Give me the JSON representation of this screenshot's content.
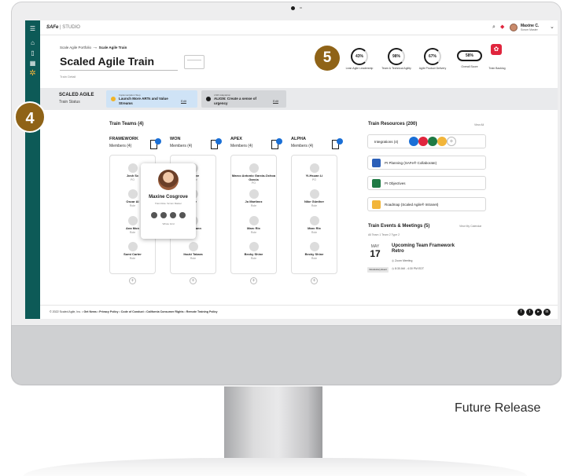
{
  "caption": "Future Release",
  "brand": {
    "logo": "SAFe",
    "sep": " | ",
    "product": "STUDIO"
  },
  "user": {
    "name": "Maxine C.",
    "role": "Scrum Master"
  },
  "breadcrumb": {
    "parent": "Scale Agile Portfolio",
    "arrow": "→",
    "current": "Scale Agile Train"
  },
  "page": {
    "title": "Scaled Agile Train",
    "subtitle": "Train Detail"
  },
  "callouts": {
    "five": "5",
    "four": "4"
  },
  "metrics": [
    {
      "value": "43%",
      "label": "Lean Agile Leadership"
    },
    {
      "value": "98%",
      "label": "Team & Technical Agility"
    },
    {
      "value": "67%",
      "label": "Agile Product Delivery"
    }
  ],
  "overall": {
    "value": "58%",
    "label": "Overall Score"
  },
  "backlog": {
    "label": "Train Backlog"
  },
  "status": {
    "title": "SCALED AGILE",
    "subtitle": "Train Status",
    "cards": [
      {
        "small": "Implementation Step",
        "big": "Launch More ARTs and Value Streams",
        "edit": "Edit",
        "dot_color": "#f0b429",
        "bg": "#cfe3f6"
      },
      {
        "small": "LSM Adaptation",
        "big": "ALIGN: Create a sense of urgency",
        "edit": "Edit",
        "dot_color": "#1b1b1b",
        "bg": "#d4d6d9"
      }
    ]
  },
  "teams": {
    "heading": "Train Teams (4)",
    "columns": [
      {
        "name": "FRAMEWORK",
        "members_label": "Members (4)",
        "members": [
          {
            "name": "Josh Sc",
            "role": "PO"
          },
          {
            "name": "Oscar Al",
            "role": "Role"
          },
          {
            "name": "Ana Mon",
            "role": "Role"
          },
          {
            "name": "Sumi Carter",
            "role": "Role"
          }
        ]
      },
      {
        "name": "WON",
        "members_label": "Members (4)",
        "members": [
          {
            "name": "osgrove",
            "role": "Master"
          },
          {
            "name": "Orce",
            "role": ""
          },
          {
            "name": "hwenmann",
            "role": "Role"
          },
          {
            "name": "Itsuki Takara",
            "role": "Role"
          }
        ]
      },
      {
        "name": "APEX",
        "members_label": "Members (4)",
        "members": [
          {
            "name": "Marco Antonio Garcia-Ochoa Garcia",
            "role": "PO"
          },
          {
            "name": "Jo Martinez",
            "role": "Role"
          },
          {
            "name": "Marc Rix",
            "role": "Role"
          },
          {
            "name": "Becky Shine",
            "role": "Role"
          }
        ]
      },
      {
        "name": "ALPHA",
        "members_label": "Members (4)",
        "members": [
          {
            "name": "Yi-Hsuan Li",
            "role": "PO"
          },
          {
            "name": "Nike Günther",
            "role": "Role"
          },
          {
            "name": "Marc Rix",
            "role": "Role"
          },
          {
            "name": "Becky Shine",
            "role": "Role"
          }
        ]
      }
    ]
  },
  "popup": {
    "name": "Maxine Cosgrove",
    "role": "Train Role: Scrum Master",
    "note": "Whole Grid"
  },
  "resources": {
    "heading": "Train Resources (200)",
    "view_all": "View All",
    "items": [
      {
        "label": "Integrations (4)"
      },
      {
        "label": "PI Planning (SAFe® Collaborate)",
        "color": "#2a5fb8"
      },
      {
        "label": "PI Objectives",
        "color": "#1e7a44"
      },
      {
        "label": "Roadmap (Scaled Agile® Intranet)",
        "color": "#f2b53a"
      }
    ],
    "integration_colors": [
      "#1a6fd6",
      "#e0253d",
      "#1e7a44",
      "#f2b53a"
    ]
  },
  "events": {
    "heading": "Train Events & Meetings (5)",
    "view_calendar": "View My Calendar",
    "filters": "All  Team 1  Team 2  Type 2",
    "month": "MAY",
    "day": "17",
    "title": "Upcoming Team Framework Retro",
    "meeting": "Zoom Meeting",
    "time": "8:30 AM - 4:30 PM EDT",
    "tag": "Introductory Event"
  },
  "footer": {
    "copyright": "© 2022 Scaled Agile, Inc.",
    "links": [
      "Get News",
      "Privacy Policy",
      "Code of Conduct",
      "California Consumer Rights",
      "Remote Training Policy"
    ]
  }
}
